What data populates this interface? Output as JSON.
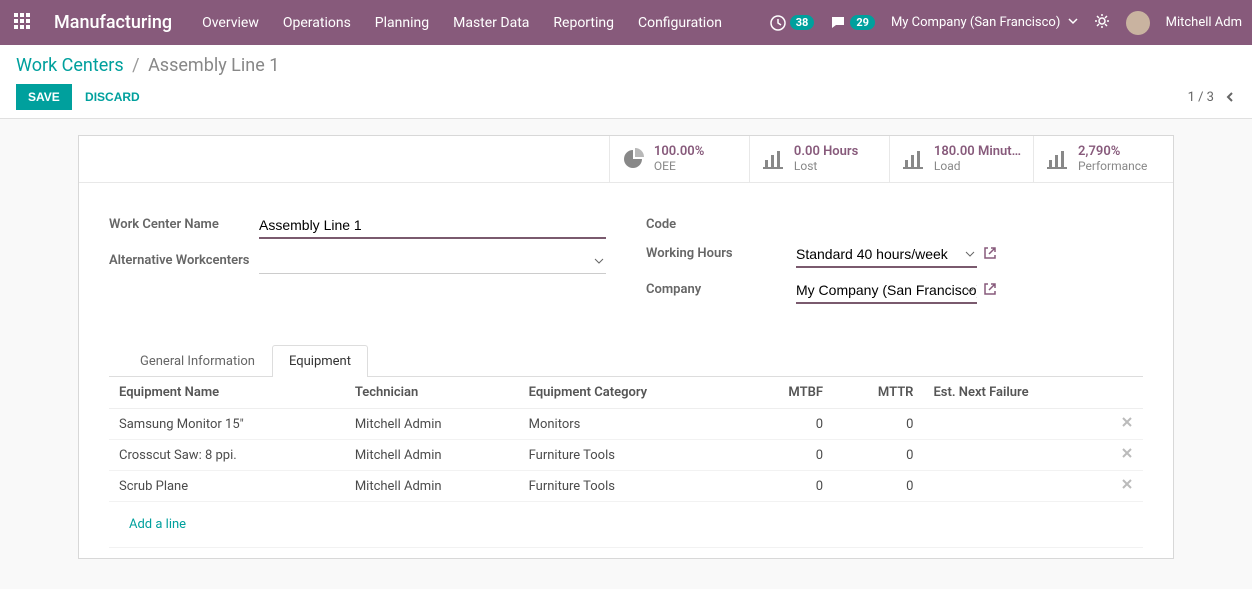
{
  "navbar": {
    "brand": "Manufacturing",
    "menu": [
      "Overview",
      "Operations",
      "Planning",
      "Master Data",
      "Reporting",
      "Configuration"
    ],
    "activity_count": "38",
    "message_count": "29",
    "company": "My Company (San Francisco)",
    "user": "Mitchell Adm"
  },
  "breadcrumb": {
    "parent": "Work Centers",
    "current": "Assembly Line 1"
  },
  "buttons": {
    "save": "SAVE",
    "discard": "DISCARD"
  },
  "pager": {
    "text": "1 / 3"
  },
  "stats": [
    {
      "value": "100.00%",
      "label": "OEE"
    },
    {
      "value": "0.00 Hours",
      "label": "Lost"
    },
    {
      "value": "180.00 Minut…",
      "label": "Load"
    },
    {
      "value": "2,790%",
      "label": "Performance"
    }
  ],
  "fields": {
    "name_label": "Work Center Name",
    "name_value": "Assembly Line 1",
    "alt_label": "Alternative Workcenters",
    "alt_value": "",
    "code_label": "Code",
    "code_value": "",
    "hours_label": "Working Hours",
    "hours_value": "Standard 40 hours/week",
    "company_label": "Company",
    "company_value": "My Company (San Francisco)"
  },
  "tabs": {
    "general": "General Information",
    "equipment": "Equipment"
  },
  "equip_table": {
    "cols": {
      "name": "Equipment Name",
      "tech": "Technician",
      "cat": "Equipment Category",
      "mtbf": "MTBF",
      "mttr": "MTTR",
      "next": "Est. Next Failure"
    },
    "rows": [
      {
        "name": "Samsung Monitor 15\"",
        "tech": "Mitchell Admin",
        "cat": "Monitors",
        "mtbf": "0",
        "mttr": "0",
        "next": ""
      },
      {
        "name": "Crosscut Saw: 8 ppi.",
        "tech": "Mitchell Admin",
        "cat": "Furniture Tools",
        "mtbf": "0",
        "mttr": "0",
        "next": ""
      },
      {
        "name": "Scrub Plane",
        "tech": "Mitchell Admin",
        "cat": "Furniture Tools",
        "mtbf": "0",
        "mttr": "0",
        "next": ""
      }
    ],
    "add_line": "Add a line"
  }
}
